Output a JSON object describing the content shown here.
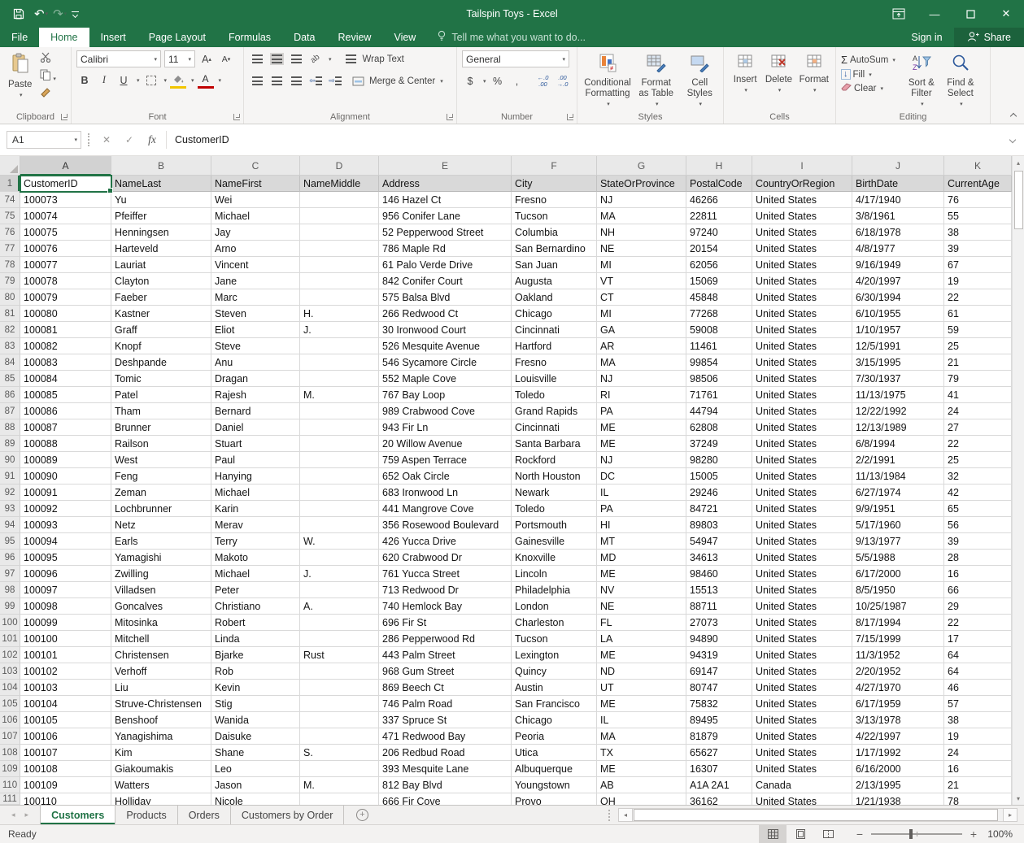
{
  "window": {
    "title": "Tailspin Toys - Excel"
  },
  "menu": {
    "tabs": [
      {
        "label": "File"
      },
      {
        "label": "Home",
        "active": true
      },
      {
        "label": "Insert"
      },
      {
        "label": "Page Layout"
      },
      {
        "label": "Formulas"
      },
      {
        "label": "Data"
      },
      {
        "label": "Review"
      },
      {
        "label": "View"
      }
    ],
    "tell_me": "Tell me what you want to do...",
    "sign_in": "Sign in",
    "share": "Share"
  },
  "ribbon": {
    "clipboard": {
      "label": "Clipboard",
      "paste": "Paste"
    },
    "font": {
      "label": "Font",
      "name": "Calibri",
      "size": "11"
    },
    "alignment": {
      "label": "Alignment",
      "wrap_text": "Wrap Text",
      "merge_center": "Merge & Center"
    },
    "number": {
      "label": "Number",
      "format": "General",
      "currency": "$",
      "percent": "%",
      "comma": ","
    },
    "styles": {
      "label": "Styles",
      "conditional": "Conditional Formatting",
      "format_table": "Format as Table",
      "cell_styles": "Cell Styles"
    },
    "cells": {
      "label": "Cells",
      "insert": "Insert",
      "delete": "Delete",
      "format": "Format"
    },
    "editing": {
      "label": "Editing",
      "autosum": "AutoSum",
      "fill": "Fill",
      "clear": "Clear",
      "sort_filter": "Sort & Filter",
      "find_select": "Find & Select"
    }
  },
  "formula_bar": {
    "name_box": "A1",
    "content": "CustomerID"
  },
  "grid": {
    "selected_cell": "A1",
    "selected_col": "A",
    "col_letters": [
      "A",
      "B",
      "C",
      "D",
      "E",
      "F",
      "G",
      "H",
      "I",
      "J",
      "K"
    ],
    "rows": [
      {
        "n": "1",
        "header": true,
        "cells": [
          "CustomerID",
          "NameLast",
          "NameFirst",
          "NameMiddle",
          "Address",
          "City",
          "StateOrProvince",
          "PostalCode",
          "CountryOrRegion",
          "BirthDate",
          "CurrentAge"
        ]
      },
      {
        "n": "74",
        "cells": [
          "100073",
          "Yu",
          "Wei",
          "",
          "146 Hazel Ct",
          "Fresno",
          "NJ",
          "46266",
          "United States",
          "4/17/1940",
          "76"
        ]
      },
      {
        "n": "75",
        "cells": [
          "100074",
          "Pfeiffer",
          "Michael",
          "",
          "956 Conifer Lane",
          "Tucson",
          "MA",
          "22811",
          "United States",
          "3/8/1961",
          "55"
        ]
      },
      {
        "n": "76",
        "cells": [
          "100075",
          "Henningsen",
          "Jay",
          "",
          "52 Pepperwood Street",
          "Columbia",
          "NH",
          "97240",
          "United States",
          "6/18/1978",
          "38"
        ]
      },
      {
        "n": "77",
        "cells": [
          "100076",
          "Harteveld",
          "Arno",
          "",
          "786 Maple Rd",
          "San Bernardino",
          "NE",
          "20154",
          "United States",
          "4/8/1977",
          "39"
        ]
      },
      {
        "n": "78",
        "cells": [
          "100077",
          "Lauriat",
          "Vincent",
          "",
          "61 Palo Verde Drive",
          "San Juan",
          "MI",
          "62056",
          "United States",
          "9/16/1949",
          "67"
        ]
      },
      {
        "n": "79",
        "cells": [
          "100078",
          "Clayton",
          "Jane",
          "",
          "842 Conifer Court",
          "Augusta",
          "VT",
          "15069",
          "United States",
          "4/20/1997",
          "19"
        ]
      },
      {
        "n": "80",
        "cells": [
          "100079",
          "Faeber",
          "Marc",
          "",
          "575 Balsa Blvd",
          "Oakland",
          "CT",
          "45848",
          "United States",
          "6/30/1994",
          "22"
        ]
      },
      {
        "n": "81",
        "cells": [
          "100080",
          "Kastner",
          "Steven",
          "H.",
          "266 Redwood Ct",
          "Chicago",
          "MI",
          "77268",
          "United States",
          "6/10/1955",
          "61"
        ]
      },
      {
        "n": "82",
        "cells": [
          "100081",
          "Graff",
          "Eliot",
          "J.",
          "30 Ironwood Court",
          "Cincinnati",
          "GA",
          "59008",
          "United States",
          "1/10/1957",
          "59"
        ]
      },
      {
        "n": "83",
        "cells": [
          "100082",
          "Knopf",
          "Steve",
          "",
          "526 Mesquite Avenue",
          "Hartford",
          "AR",
          "11461",
          "United States",
          "12/5/1991",
          "25"
        ]
      },
      {
        "n": "84",
        "cells": [
          "100083",
          "Deshpande",
          "Anu",
          "",
          "546 Sycamore Circle",
          "Fresno",
          "MA",
          "99854",
          "United States",
          "3/15/1995",
          "21"
        ]
      },
      {
        "n": "85",
        "cells": [
          "100084",
          "Tomic",
          "Dragan",
          "",
          "552 Maple Cove",
          "Louisville",
          "NJ",
          "98506",
          "United States",
          "7/30/1937",
          "79"
        ]
      },
      {
        "n": "86",
        "cells": [
          "100085",
          "Patel",
          "Rajesh",
          "M.",
          "767 Bay Loop",
          "Toledo",
          "RI",
          "71761",
          "United States",
          "11/13/1975",
          "41"
        ]
      },
      {
        "n": "87",
        "cells": [
          "100086",
          "Tham",
          "Bernard",
          "",
          "989 Crabwood Cove",
          "Grand Rapids",
          "PA",
          "44794",
          "United States",
          "12/22/1992",
          "24"
        ]
      },
      {
        "n": "88",
        "cells": [
          "100087",
          "Brunner",
          "Daniel",
          "",
          "943 Fir Ln",
          "Cincinnati",
          "ME",
          "62808",
          "United States",
          "12/13/1989",
          "27"
        ]
      },
      {
        "n": "89",
        "cells": [
          "100088",
          "Railson",
          "Stuart",
          "",
          "20 Willow Avenue",
          "Santa Barbara",
          "ME",
          "37249",
          "United States",
          "6/8/1994",
          "22"
        ]
      },
      {
        "n": "90",
        "cells": [
          "100089",
          "West",
          "Paul",
          "",
          "759 Aspen Terrace",
          "Rockford",
          "NJ",
          "98280",
          "United States",
          "2/2/1991",
          "25"
        ]
      },
      {
        "n": "91",
        "cells": [
          "100090",
          "Feng",
          "Hanying",
          "",
          "652 Oak Circle",
          "North Houston",
          "DC",
          "15005",
          "United States",
          "11/13/1984",
          "32"
        ]
      },
      {
        "n": "92",
        "cells": [
          "100091",
          "Zeman",
          "Michael",
          "",
          "683 Ironwood Ln",
          "Newark",
          "IL",
          "29246",
          "United States",
          "6/27/1974",
          "42"
        ]
      },
      {
        "n": "93",
        "cells": [
          "100092",
          "Lochbrunner",
          "Karin",
          "",
          "441 Mangrove Cove",
          "Toledo",
          "PA",
          "84721",
          "United States",
          "9/9/1951",
          "65"
        ]
      },
      {
        "n": "94",
        "cells": [
          "100093",
          "Netz",
          "Merav",
          "",
          "356 Rosewood Boulevard",
          "Portsmouth",
          "HI",
          "89803",
          "United States",
          "5/17/1960",
          "56"
        ]
      },
      {
        "n": "95",
        "cells": [
          "100094",
          "Earls",
          "Terry",
          "W.",
          "426 Yucca Drive",
          "Gainesville",
          "MT",
          "54947",
          "United States",
          "9/13/1977",
          "39"
        ]
      },
      {
        "n": "96",
        "cells": [
          "100095",
          "Yamagishi",
          "Makoto",
          "",
          "620 Crabwood Dr",
          "Knoxville",
          "MD",
          "34613",
          "United States",
          "5/5/1988",
          "28"
        ]
      },
      {
        "n": "97",
        "cells": [
          "100096",
          "Zwilling",
          "Michael",
          "J.",
          "761 Yucca Street",
          "Lincoln",
          "ME",
          "98460",
          "United States",
          "6/17/2000",
          "16"
        ]
      },
      {
        "n": "98",
        "cells": [
          "100097",
          "Villadsen",
          "Peter",
          "",
          "713 Redwood Dr",
          "Philadelphia",
          "NV",
          "15513",
          "United States",
          "8/5/1950",
          "66"
        ]
      },
      {
        "n": "99",
        "cells": [
          "100098",
          "Goncalves",
          "Christiano",
          "A.",
          "740 Hemlock Bay",
          "London",
          "NE",
          "88711",
          "United States",
          "10/25/1987",
          "29"
        ]
      },
      {
        "n": "100",
        "cells": [
          "100099",
          "Mitosinka",
          "Robert",
          "",
          "696 Fir St",
          "Charleston",
          "FL",
          "27073",
          "United States",
          "8/17/1994",
          "22"
        ]
      },
      {
        "n": "101",
        "cells": [
          "100100",
          "Mitchell",
          "Linda",
          "",
          "286 Pepperwood Rd",
          "Tucson",
          "LA",
          "94890",
          "United States",
          "7/15/1999",
          "17"
        ]
      },
      {
        "n": "102",
        "cells": [
          "100101",
          "Christensen",
          "Bjarke",
          "Rust",
          "443 Palm Street",
          "Lexington",
          "ME",
          "94319",
          "United States",
          "11/3/1952",
          "64"
        ]
      },
      {
        "n": "103",
        "cells": [
          "100102",
          "Verhoff",
          "Rob",
          "",
          "968 Gum Street",
          "Quincy",
          "ND",
          "69147",
          "United States",
          "2/20/1952",
          "64"
        ]
      },
      {
        "n": "104",
        "cells": [
          "100103",
          "Liu",
          "Kevin",
          "",
          "869 Beech Ct",
          "Austin",
          "UT",
          "80747",
          "United States",
          "4/27/1970",
          "46"
        ]
      },
      {
        "n": "105",
        "cells": [
          "100104",
          "Struve-Christensen",
          "Stig",
          "",
          "746 Palm Road",
          "San Francisco",
          "ME",
          "75832",
          "United States",
          "6/17/1959",
          "57"
        ]
      },
      {
        "n": "106",
        "cells": [
          "100105",
          "Benshoof",
          "Wanida",
          "",
          "337 Spruce St",
          "Chicago",
          "IL",
          "89495",
          "United States",
          "3/13/1978",
          "38"
        ]
      },
      {
        "n": "107",
        "cells": [
          "100106",
          "Yanagishima",
          "Daisuke",
          "",
          "471 Redwood Bay",
          "Peoria",
          "MA",
          "81879",
          "United States",
          "4/22/1997",
          "19"
        ]
      },
      {
        "n": "108",
        "cells": [
          "100107",
          "Kim",
          "Shane",
          "S.",
          "206 Redbud Road",
          "Utica",
          "TX",
          "65627",
          "United States",
          "1/17/1992",
          "24"
        ]
      },
      {
        "n": "109",
        "cells": [
          "100108",
          "Giakoumakis",
          "Leo",
          "",
          "393 Mesquite Lane",
          "Albuquerque",
          "ME",
          "16307",
          "United States",
          "6/16/2000",
          "16"
        ]
      },
      {
        "n": "110",
        "cells": [
          "100109",
          "Watters",
          "Jason",
          "M.",
          "812 Bay Blvd",
          "Youngstown",
          "AB",
          "A1A 2A1",
          "Canada",
          "2/13/1995",
          "21"
        ]
      }
    ],
    "partial_row": {
      "n": "111",
      "cells": [
        "100110",
        "Holliday",
        "Nicole",
        "",
        "666 Fir Cove",
        "Provo",
        "OH",
        "36162",
        "United States",
        "1/21/1938",
        "78"
      ]
    }
  },
  "sheet_tabs": [
    {
      "label": "Customers",
      "active": true
    },
    {
      "label": "Products"
    },
    {
      "label": "Orders"
    },
    {
      "label": "Customers by Order"
    }
  ],
  "status_bar": {
    "mode": "Ready",
    "zoom_level": "100%"
  }
}
